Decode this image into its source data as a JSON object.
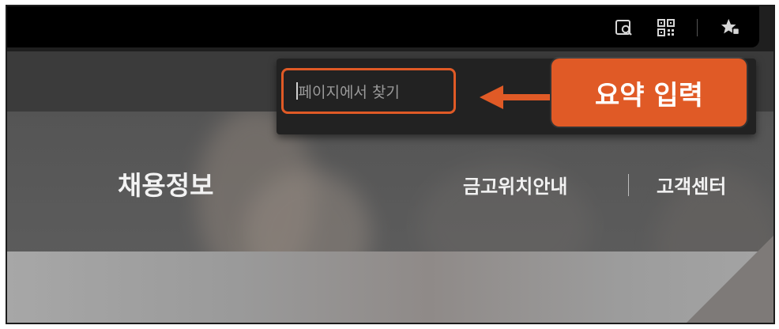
{
  "browser_bar": {
    "icons": [
      "page-search-icon",
      "qr-code-icon",
      "favorites-star-icon"
    ]
  },
  "find_bar": {
    "placeholder": "페이지에서 찾기"
  },
  "callout": {
    "label": "요약 입력",
    "color": "#e05a26"
  },
  "site_nav": {
    "left_item": "채용정보",
    "right_items": [
      "금고위치안내",
      "고객센터"
    ]
  }
}
